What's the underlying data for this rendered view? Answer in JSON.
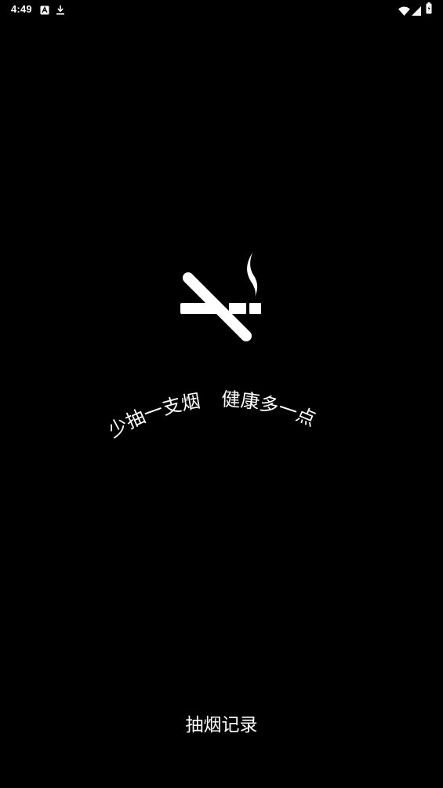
{
  "status_bar": {
    "time": "4:49",
    "left_icons": [
      "a-notification-icon",
      "download-icon"
    ],
    "right_icons": [
      "wifi-icon",
      "signal-icon",
      "battery-icon"
    ]
  },
  "splash": {
    "logo_icon": "no-smoking-icon",
    "slogan_part1": "少抽一支烟",
    "slogan_part2": "健康多一点",
    "colors": {
      "background": "#000000",
      "foreground": "#ffffff"
    }
  },
  "bottom": {
    "link_label": "抽烟记录"
  }
}
